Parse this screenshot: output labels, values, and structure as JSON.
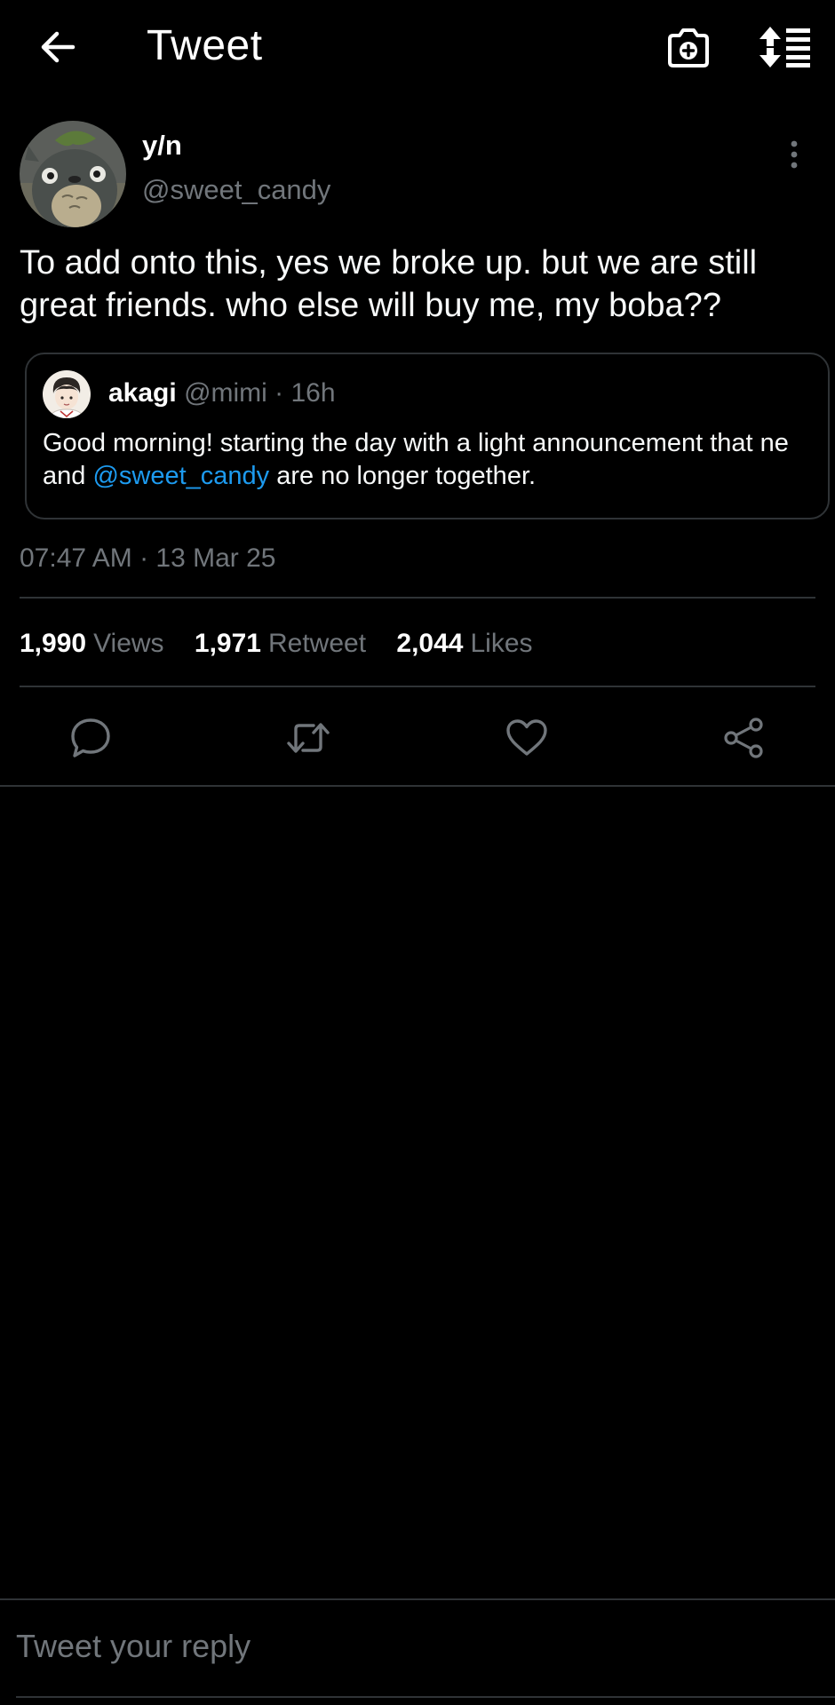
{
  "header": {
    "title": "Tweet"
  },
  "tweet": {
    "display_name": "y/n",
    "handle": "@sweet_candy",
    "text": "To add onto this, yes we broke up. but we are still great friends. who else will buy me, my boba??",
    "timestamp": "07:47 AM · 13 Mar 25",
    "stats": {
      "views_count": "1,990",
      "views_label": "Views",
      "retweets_count": "1,971",
      "retweets_label": "Retweet",
      "likes_count": "2,044",
      "likes_label": "Likes"
    }
  },
  "quoted": {
    "name": "akagi",
    "handle": "@mimi",
    "time": " · 16h",
    "text_before": "Good morning! starting the day with a light announcement that ne and ",
    "mention": "@sweet_candy",
    "text_after": " are no longer together."
  },
  "reply": {
    "placeholder": "Tweet your reply"
  },
  "colors": {
    "background": "#000000",
    "muted": "#71767b",
    "accent": "#1d9bf0",
    "border": "#2f3336"
  },
  "icons": {
    "back": "arrow-left-icon",
    "camera": "camera-plus-icon",
    "sort": "sort-list-icon",
    "more": "more-vertical-icon",
    "reply": "comment-icon",
    "retweet": "retweet-icon",
    "like": "heart-icon",
    "share": "share-icon"
  }
}
